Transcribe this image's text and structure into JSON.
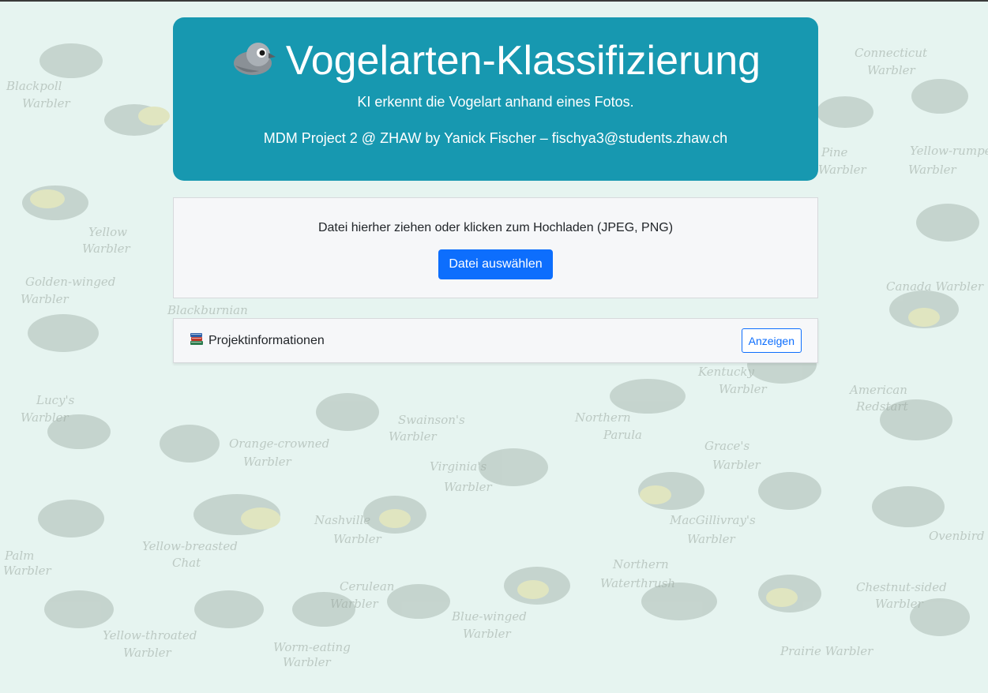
{
  "header": {
    "icon": "bird-icon",
    "title": "Vogelarten-Klassifizierung",
    "subtitle": "KI erkennt die Vogelart anhand eines Fotos.",
    "author_line": "MDM Project 2 @ ZHAW by Yanick Fischer – fischya3@students.zhaw.ch",
    "background_color": "#1798b0"
  },
  "upload": {
    "hint": "Datei hierher ziehen oder klicken zum Hochladen (JPEG, PNG)",
    "button_label": "Datei auswählen",
    "button_color": "#0d6efd"
  },
  "project_info": {
    "icon": "books-icon",
    "label": "Projektinformationen",
    "button_label": "Anzeigen"
  },
  "wallpaper": {
    "labels": [
      "Blackpoll",
      "Warbler",
      "Yellow",
      "Warbler",
      "Golden-winged",
      "Warbler",
      "Lucy's",
      "Warbler",
      "Palm",
      "Warbler",
      "Yellow-breasted",
      "Chat",
      "Yellow-throated",
      "Warbler",
      "Orange-crowned",
      "Warbler",
      "Nashville",
      "Warbler",
      "Cerulean",
      "Warbler",
      "Worm-eating",
      "Warbler",
      "Swainson's",
      "Warbler",
      "Virginia's",
      "Warbler",
      "Blue-winged",
      "Warbler",
      "Northern",
      "Parula",
      "MacGillivray's",
      "Warbler",
      "Northern",
      "Waterthrush",
      "Kentucky",
      "Warbler",
      "Grace's",
      "Warbler",
      "Connecticut",
      "Warbler",
      "Yellow-rumped",
      "Warbler",
      "Canada Warbler",
      "American",
      "Redstart",
      "Ovenbird",
      "Chestnut-sided",
      "Warbler",
      "Prairie Warbler",
      "Pine",
      "Warbler",
      "Blackburnian"
    ]
  }
}
